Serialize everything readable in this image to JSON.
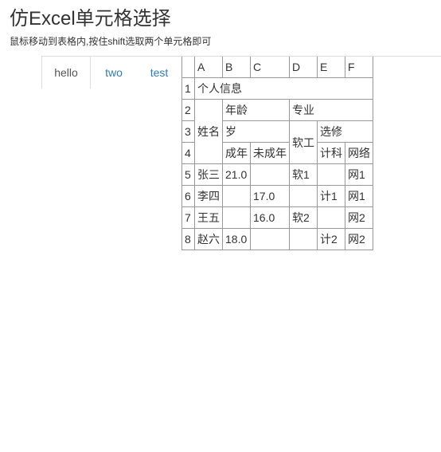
{
  "page": {
    "title": "仿Excel单元格选择",
    "subtitle": "鼠标移动到表格内,按住shift选取两个单元格即可"
  },
  "tabs": [
    {
      "label": "hello",
      "active": true
    },
    {
      "label": "two",
      "active": false
    },
    {
      "label": "test",
      "active": false
    }
  ],
  "sheet": {
    "columns": [
      "A",
      "B",
      "C",
      "D",
      "E",
      "F"
    ],
    "row_numbers": [
      "1",
      "2",
      "3",
      "4",
      "5",
      "6",
      "7",
      "8"
    ],
    "header_cells": {
      "r1_A": "个人信息",
      "r2_A": "姓名",
      "r2_B": "年龄",
      "r2_D": "专业",
      "r3_B": "岁",
      "r3_D": "软工",
      "r3_E": "选修",
      "r4_B": "成年",
      "r4_C": "未成年",
      "r4_E": "计科",
      "r4_F": "网络"
    },
    "data_rows": [
      {
        "A": "张三",
        "B": "21.0",
        "C": "",
        "D": "软1",
        "E": "",
        "F": "网1"
      },
      {
        "A": "李四",
        "B": "",
        "C": "17.0",
        "D": "",
        "E": "计1",
        "F": "网1"
      },
      {
        "A": "王五",
        "B": "",
        "C": "16.0",
        "D": "软2",
        "E": "",
        "F": "网2"
      },
      {
        "A": "赵六",
        "B": "18.0",
        "C": "",
        "D": "",
        "E": "计2",
        "F": "网2"
      }
    ]
  }
}
